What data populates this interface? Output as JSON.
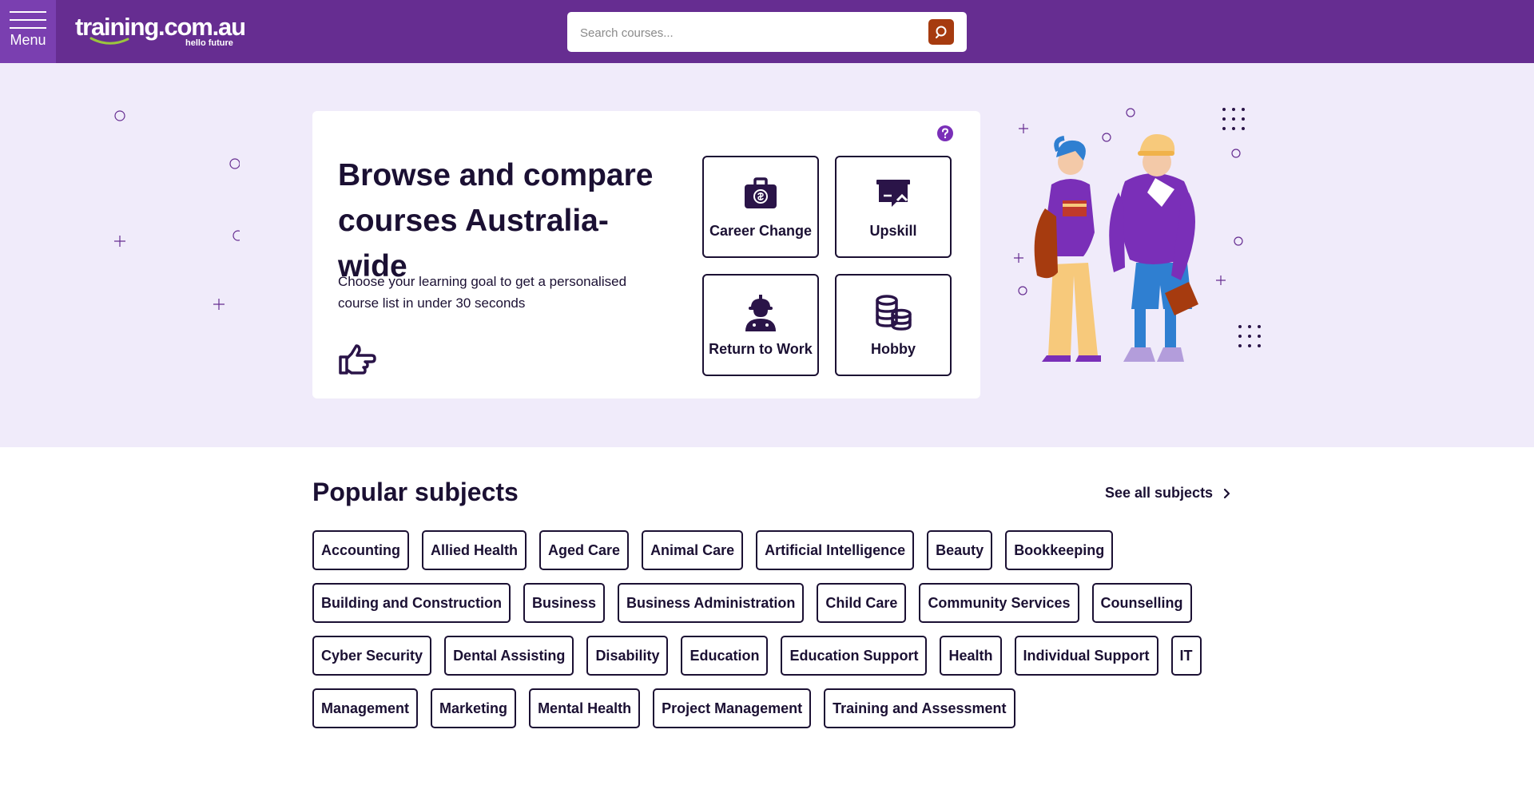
{
  "header": {
    "menu_label": "Menu",
    "logo_text": "training.com.au",
    "logo_tagline": "hello future",
    "search_placeholder": "Search courses...",
    "brand_color": "#662d91",
    "search_button_color": "#a63b0f"
  },
  "hero": {
    "title": "Browse and compare courses Australia-wide",
    "subtitle": "Choose your learning goal to get a personalised course list in under 30 seconds",
    "goals": [
      {
        "label": "Career Change",
        "icon": "briefcase-icon"
      },
      {
        "label": "Upskill",
        "icon": "upskill-board-icon"
      },
      {
        "label": "Return to Work",
        "icon": "worker-icon"
      },
      {
        "label": "Hobby",
        "icon": "coins-icon"
      }
    ]
  },
  "subjects": {
    "title": "Popular subjects",
    "see_all_label": "See all subjects",
    "rows": [
      [
        "Accounting",
        "Allied Health",
        "Aged Care",
        "Animal Care",
        "Artificial Intelligence",
        "Beauty",
        "Bookkeeping"
      ],
      [
        "Building and Construction",
        "Business",
        "Business Administration",
        "Child Care",
        "Community Services",
        "Counselling"
      ],
      [
        "Cyber Security",
        "Dental Assisting",
        "Disability",
        "Education",
        "Education Support",
        "Health",
        "Individual Support",
        "IT"
      ],
      [
        "Management",
        "Marketing",
        "Mental Health",
        "Project Management",
        "Training and Assessment"
      ]
    ]
  }
}
